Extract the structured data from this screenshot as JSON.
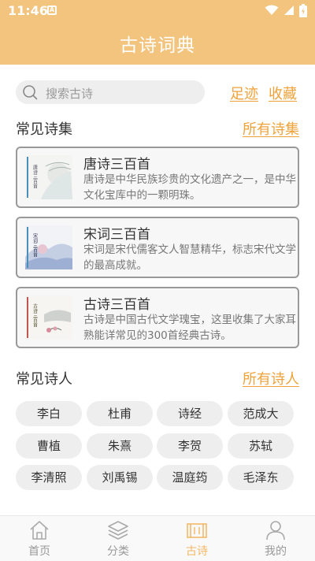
{
  "status_bar": {
    "time": "11:46",
    "notification_letter": "A"
  },
  "header": {
    "title": "古诗词典"
  },
  "search": {
    "placeholder": "搜索古诗",
    "footprint_label": "足迹",
    "favorites_label": "收藏"
  },
  "collections": {
    "title": "常见诗集",
    "more_label": "所有诗集",
    "items": [
      {
        "title": "唐诗三百首",
        "desc": "唐诗是中华民族珍贵的文化遗产之一，是中华文化宝库中的一颗明珠。",
        "cover_text": "唐诗三百首"
      },
      {
        "title": "宋词三百首",
        "desc": "宋词是宋代儒客文人智慧精华，标志宋代文学的最高成就。",
        "cover_text": "宋词三百首"
      },
      {
        "title": "古诗三百首",
        "desc": "古诗是中国古代文学瑰宝，这里收集了大家耳熟能详常见的300首经典古诗。",
        "cover_text": "古诗三百首"
      }
    ]
  },
  "poets": {
    "title": "常见诗人",
    "more_label": "所有诗人",
    "items": [
      "李白",
      "杜甫",
      "诗经",
      "范成大",
      "曹植",
      "朱熹",
      "李贺",
      "苏轼",
      "李清照",
      "刘禹锡",
      "温庭筠",
      "毛泽东"
    ]
  },
  "tabbar": {
    "active_index": 2,
    "items": [
      {
        "label": "首页",
        "icon": "home-icon"
      },
      {
        "label": "分类",
        "icon": "layers-icon"
      },
      {
        "label": "古诗",
        "icon": "scroll-icon"
      },
      {
        "label": "我的",
        "icon": "user-icon"
      }
    ]
  },
  "colors": {
    "accent": "#f3c47e",
    "link": "#f0a23a",
    "active_tab": "#f3b866"
  }
}
